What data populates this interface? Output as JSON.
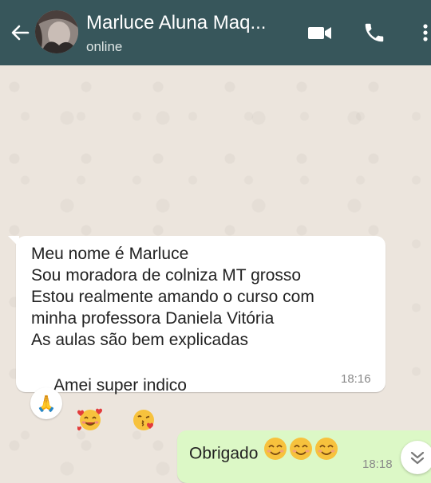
{
  "header": {
    "contact_name": "Marluce Aluna Maq...",
    "status": "online",
    "icons": [
      "back-arrow-icon",
      "video-call-icon",
      "phone-icon",
      "more-vert-icon"
    ],
    "color": "#37565b"
  },
  "messages": [
    {
      "direction": "incoming",
      "lines": [
        "Meu nome é Marluce",
        "Sou moradora de colniza MT grosso",
        "Estou realmente amando o curso com",
        "minha professora Daniela Vitória",
        " As aulas são bem explicadas",
        " Amei super indico"
      ],
      "emojis": [
        "smiling-face-with-hearts",
        "face-blowing-kiss"
      ],
      "time": "18:16",
      "reaction": "🙏"
    },
    {
      "direction": "outgoing",
      "text": "Obrigado",
      "emojis": [
        "smiling-face",
        "smiling-face",
        "smiling-face"
      ],
      "time": "18:18"
    }
  ],
  "colors": {
    "incoming_bubble": "#ffffff",
    "outgoing_bubble": "#dcf8c6",
    "chat_background": "#ece5dd"
  }
}
